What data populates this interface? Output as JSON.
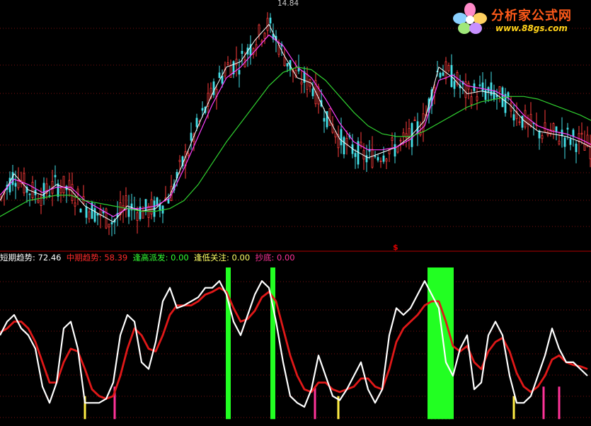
{
  "watermark": {
    "text": "分析家公式网",
    "url": "www.88gs.com"
  },
  "top_panel": {
    "peak_label": "14.84",
    "divider_mark": "$"
  },
  "indicator_legend": {
    "short_trend": {
      "label": "短期趋势",
      "value": "72.46",
      "color": "#ffffff"
    },
    "mid_trend": {
      "label": "中期趋势",
      "value": "58.39",
      "color": "#ff2a2a"
    },
    "high_sell": {
      "label": "逢高派发",
      "value": "0.00",
      "color": "#33ff33"
    },
    "low_watch": {
      "label": "逢低关注",
      "value": "0.00",
      "color": "#ffff66"
    },
    "bottom_fish": {
      "label": "抄底",
      "value": "0.00",
      "color": "#ff3399"
    }
  },
  "chart_data": [
    {
      "type": "line",
      "x": [
        0,
        20,
        40,
        60,
        80,
        100,
        120,
        140,
        160,
        180,
        200,
        220,
        240,
        260,
        280,
        300,
        320,
        340,
        360,
        380,
        400,
        420,
        440,
        460,
        480,
        500,
        520,
        540,
        560,
        580,
        600,
        620,
        640,
        660,
        680,
        700,
        720,
        740,
        760,
        780,
        800,
        820,
        835
      ],
      "series": [
        {
          "values": [
            8.0,
            9.0,
            8.4,
            8.2,
            8.6,
            8.4,
            7.8,
            7.5,
            7.2,
            7.8,
            7.6,
            7.7,
            8.2,
            9.5,
            10.8,
            12.0,
            13.0,
            13.2,
            14.0,
            14.6,
            13.5,
            12.6,
            12.4,
            11.3,
            10.3,
            9.9,
            9.6,
            9.8,
            10.0,
            10.4,
            11.0,
            13.0,
            12.6,
            12.0,
            12.1,
            12.0,
            11.6,
            11.0,
            10.6,
            10.5,
            10.4,
            10.2,
            10.0
          ]
        },
        {
          "values": [
            8.2,
            8.8,
            8.6,
            8.3,
            8.5,
            8.5,
            8.0,
            7.7,
            7.4,
            7.7,
            7.7,
            7.8,
            8.1,
            9.2,
            10.4,
            11.6,
            12.6,
            13.0,
            13.6,
            14.2,
            13.8,
            13.0,
            12.6,
            11.8,
            10.9,
            10.2,
            9.9,
            9.9,
            10.0,
            10.3,
            10.8,
            12.5,
            12.7,
            12.3,
            12.2,
            12.1,
            11.8,
            11.2,
            10.8,
            10.6,
            10.5,
            10.3,
            10.1
          ]
        },
        {
          "values": [
            7.4,
            7.7,
            8.0,
            8.1,
            8.2,
            8.2,
            8.0,
            7.9,
            7.8,
            7.7,
            7.6,
            7.6,
            7.7,
            8.0,
            8.6,
            9.4,
            10.2,
            10.9,
            11.6,
            12.3,
            12.8,
            13.0,
            12.9,
            12.5,
            11.9,
            11.3,
            10.8,
            10.5,
            10.4,
            10.4,
            10.6,
            10.9,
            11.2,
            11.5,
            11.7,
            11.8,
            11.9,
            11.9,
            11.8,
            11.6,
            11.4,
            11.2,
            11.0
          ]
        }
      ],
      "ylim": [
        6.5,
        15.3
      ],
      "peak_label": "14.84",
      "grid": true
    },
    {
      "type": "line",
      "x": [
        0,
        10,
        20,
        30,
        40,
        50,
        60,
        70,
        80,
        90,
        100,
        110,
        120,
        130,
        140,
        150,
        160,
        170,
        180,
        190,
        200,
        210,
        220,
        230,
        240,
        250,
        260,
        270,
        280,
        290,
        300,
        310,
        320,
        330,
        340,
        350,
        360,
        370,
        380,
        390,
        400,
        410,
        420,
        430,
        440,
        450,
        460,
        470,
        480,
        490,
        500,
        510,
        520,
        530,
        540,
        550,
        560,
        570,
        580,
        590,
        600,
        610,
        620,
        630,
        640,
        650,
        660,
        670,
        680,
        690,
        700,
        710,
        720,
        730,
        740,
        750,
        760,
        770,
        780,
        790,
        800,
        810,
        820,
        830
      ],
      "series": [
        {
          "name": "短期趋势",
          "values": [
            50,
            60,
            65,
            55,
            50,
            40,
            12,
            0,
            15,
            55,
            60,
            40,
            0,
            0,
            0,
            3,
            15,
            50,
            65,
            60,
            30,
            25,
            45,
            75,
            85,
            70,
            72,
            75,
            78,
            85,
            85,
            90,
            80,
            60,
            50,
            65,
            80,
            90,
            85,
            60,
            30,
            5,
            0,
            -3,
            10,
            35,
            20,
            5,
            2,
            10,
            20,
            30,
            10,
            0,
            10,
            50,
            70,
            65,
            70,
            80,
            90,
            80,
            70,
            30,
            20,
            40,
            50,
            10,
            15,
            50,
            60,
            50,
            20,
            0,
            0,
            5,
            20,
            35,
            55,
            40,
            30,
            30,
            25,
            20
          ]
        },
        {
          "name": "中期趋势",
          "values": [
            52,
            55,
            60,
            60,
            55,
            45,
            30,
            15,
            15,
            30,
            40,
            38,
            25,
            10,
            5,
            3,
            5,
            20,
            40,
            55,
            50,
            40,
            38,
            50,
            65,
            72,
            72,
            72,
            75,
            80,
            82,
            85,
            82,
            70,
            60,
            62,
            68,
            78,
            82,
            75,
            55,
            35,
            20,
            10,
            8,
            15,
            15,
            10,
            8,
            10,
            12,
            18,
            18,
            12,
            10,
            25,
            45,
            55,
            60,
            65,
            72,
            75,
            75,
            60,
            42,
            38,
            42,
            30,
            25,
            38,
            45,
            48,
            38,
            22,
            12,
            8,
            12,
            20,
            32,
            35,
            30,
            28,
            27,
            25
          ]
        }
      ],
      "bars": {
        "high_sell_x": [
          322,
          385,
          607,
          612,
          617,
          622,
          627,
          632,
          637
        ],
        "low_watch_x": [
          120,
          478,
          726
        ],
        "bottom_fish_x": [
          162,
          445,
          768,
          790
        ]
      },
      "ylim": [
        -15,
        100
      ],
      "grid": true
    }
  ]
}
